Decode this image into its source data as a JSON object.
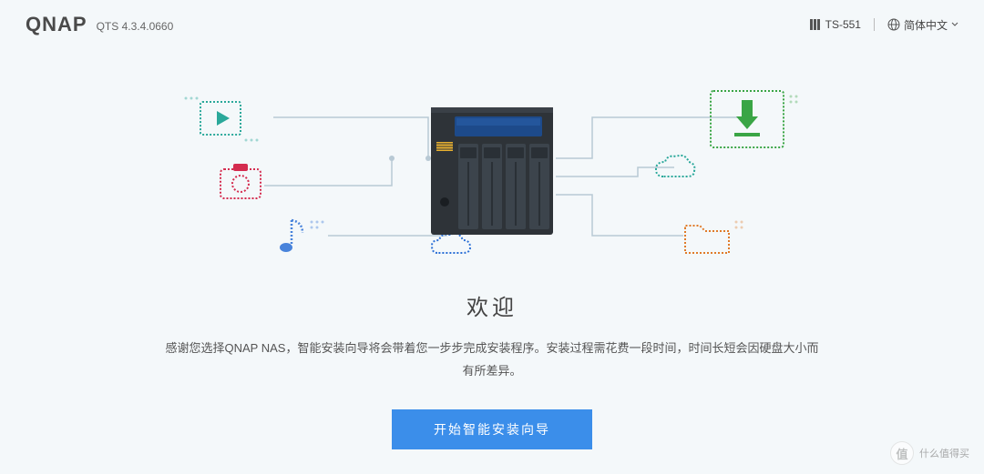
{
  "header": {
    "brand": "QNAP",
    "version": "QTS 4.3.4.0660",
    "model": "TS-551",
    "language": "简体中文"
  },
  "welcome": {
    "title": "欢迎",
    "description": "感谢您选择QNAP NAS，智能安装向导将会带着您一步步完成安装程序。安装过程需花费一段时间，时间长短会因硬盘大小而有所差异。",
    "start_button": "开始智能安装向导"
  },
  "watermark": {
    "icon_text": "值",
    "label": "什么值得买"
  },
  "colors": {
    "accent": "#3b8eea",
    "bg": "#f4f8fa",
    "nas_dark": "#2e3338",
    "nas_screen": "#1d4a8a",
    "dot_teal": "#2aa89a",
    "dot_red": "#d42c4f",
    "dot_blue": "#2b6fd6",
    "dot_green": "#3aa545",
    "dot_orange": "#e07b2a"
  }
}
